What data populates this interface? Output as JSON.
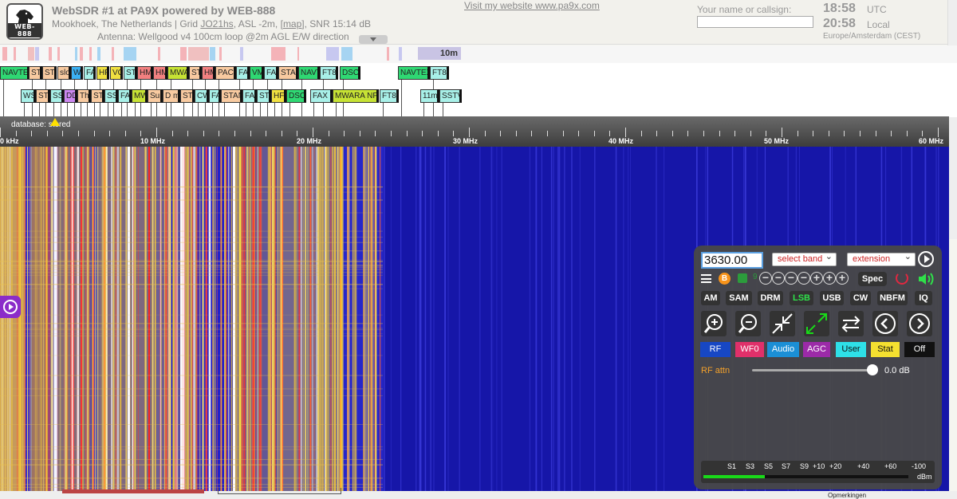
{
  "header": {
    "logo_text": "WEB-888",
    "title": "WebSDR #1 at PA9X powered by WEB-888",
    "subtitle_prefix": "Mookhoek, The Netherlands | Grid ",
    "grid": "JO21hs",
    "subtitle_mid": ", ASL -2m, [",
    "map_link": "map",
    "subtitle_end": "], SNR 15:14 dB",
    "antenna": "Antenna: Wellgood v4 100cm loop @2m AGL E/W direction",
    "website_link": "Visit my website www.pa9x.com",
    "name_label": "Your name or callsign:",
    "name_value": "",
    "time_utc": "18:58",
    "utc_label": "UTC",
    "time_local": "20:58",
    "local_label": "Local",
    "timezone": "Europe/Amsterdam (CEST)"
  },
  "bandbar": {
    "band_10m": "10m"
  },
  "labels": {
    "row1": [
      "NAVTEX",
      "STA",
      "STA",
      "slo",
      "WW",
      "FAX",
      "HFD",
      "VO",
      "STA",
      "HM",
      "HM",
      "MWA",
      "STA",
      "HM",
      "PACS",
      "FAX",
      "VM",
      "FAX",
      "STAN",
      "NAVT",
      "FT8",
      "DSC",
      "NAVTEX",
      "FT8"
    ],
    "row2": [
      "WS",
      "STA",
      "SS",
      "DD",
      "Thi",
      "STA",
      "SS",
      "FA",
      "MW",
      "Sup",
      "D m",
      "STA",
      "CW",
      "FA",
      "STAN",
      "FAX",
      "STA",
      "HFD",
      "DSC",
      "FAX",
      "MWARA NP",
      "FT8",
      "11m",
      "SSTV"
    ]
  },
  "scale": {
    "database_label": "database: stored",
    "ticks": [
      "0 kHz",
      "10 MHz",
      "20 MHz",
      "30 MHz",
      "40 MHz",
      "50 MHz",
      "60 MHz"
    ]
  },
  "panel": {
    "frequency": "3630.00",
    "band_select": "select band",
    "extension_select": "extension",
    "btc_icon": "B",
    "ext_num": "9",
    "zoom_icons": [
      "−",
      "−",
      "−",
      "−",
      "+",
      "+",
      "+"
    ],
    "spec_label": "Spec",
    "modes": [
      "AM",
      "SAM",
      "DRM",
      "LSB",
      "USB",
      "CW",
      "NBFM",
      "IQ"
    ],
    "active_mode": "LSB",
    "tabs": [
      "RF",
      "WF0",
      "Audio",
      "AGC",
      "User",
      "Stat",
      "Off"
    ],
    "rf_attn_label": "RF attn",
    "rf_attn_value": "0.0 dB",
    "rf_attn_level_fraction": 1.0,
    "smeter_labels": [
      "S1",
      "S3",
      "S5",
      "S7",
      "S9",
      "+10",
      "+20",
      "+40",
      "+60",
      "-100"
    ],
    "smeter_unit": "dBm",
    "smeter_fill_fraction": 0.3
  },
  "footer": {
    "opmerkingen": "Opmerkingen"
  }
}
